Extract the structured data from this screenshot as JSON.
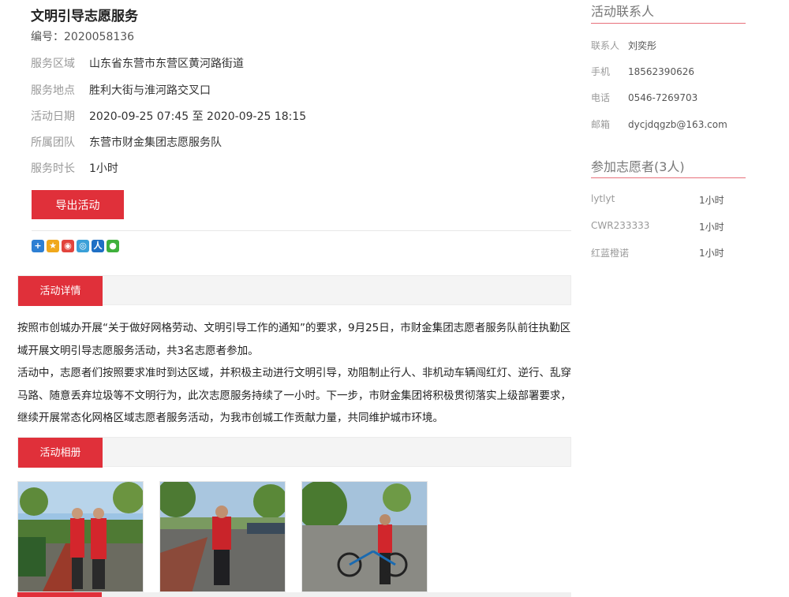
{
  "activity": {
    "title": "文明引导志愿服务",
    "code": "编号：2020058136",
    "info": [
      {
        "label": "服务区域",
        "value": "山东省东营市东营区黄河路街道"
      },
      {
        "label": "服务地点",
        "value": "胜利大街与淮河路交叉口"
      },
      {
        "label": "活动日期",
        "value": "2020-09-25 07:45 至 2020-09-25 18:15"
      },
      {
        "label": "所属团队",
        "value": "东营市财金集团志愿服务队"
      },
      {
        "label": "服务时长",
        "value": "1小时"
      }
    ],
    "export_label": "导出活动"
  },
  "share_icons": [
    "plus-share-icon",
    "qzone-icon",
    "weibo-icon",
    "tencent-weibo-icon",
    "renren-icon",
    "wechat-icon"
  ],
  "sections": {
    "detail_tab": "活动详情",
    "album_tab": "活动相册"
  },
  "detail_paragraphs": [
    "按照市创城办开展“关于做好网格劳动、文明引导工作的通知”的要求，9月25日，市财金集团志愿者服务队前往执勤区域开展文明引导志愿服务活动，共3名志愿者参加。",
    "活动中，志愿者们按照要求准时到达区域，并积极主动进行文明引导，劝阻制止行人、非机动车辆闯红灯、逆行、乱穿马路、随意丢弃垃圾等不文明行为，此次志愿服务持续了一小时。下一步，市财金集团将积极贯彻落实上级部署要求，继续开展常态化网格区域志愿者服务活动，为我市创城工作贡献力量，共同维护城市环境。"
  ],
  "contact": {
    "heading": "活动联系人",
    "rows": [
      {
        "label": "联系人",
        "value": "刘奕彤"
      },
      {
        "label": "手机",
        "value": "18562390626"
      },
      {
        "label": "电话",
        "value": "0546-7269703"
      },
      {
        "label": "邮箱",
        "value": "dycjdqgzb@163.com"
      }
    ]
  },
  "volunteers": {
    "heading": "参加志愿者(3人)",
    "rows": [
      {
        "name": "lytlyt",
        "hours": "1小时"
      },
      {
        "name": "CWR233333",
        "hours": "1小时"
      },
      {
        "name": "红蓝橙诺",
        "hours": "1小时"
      }
    ]
  },
  "colors": {
    "accent": "#e0303a",
    "rule": "#e8707a"
  }
}
